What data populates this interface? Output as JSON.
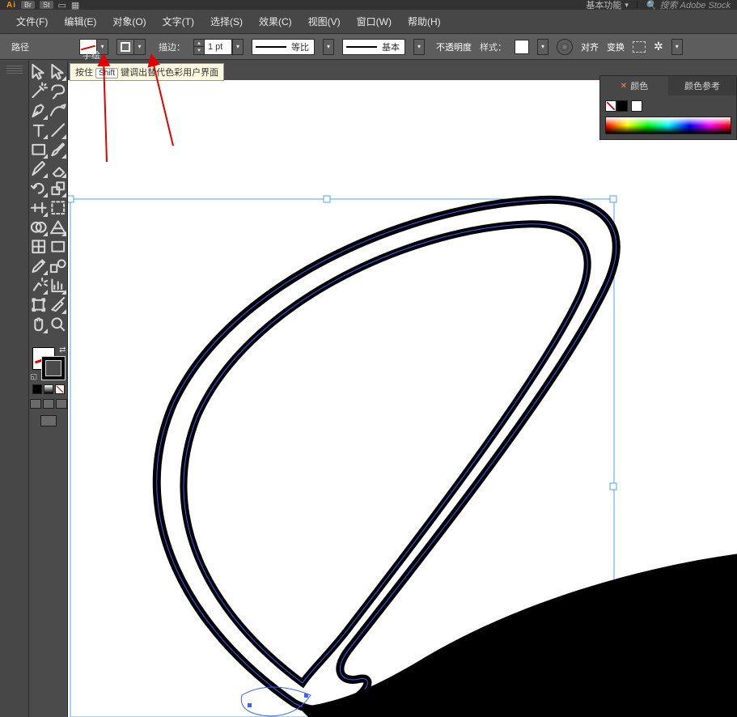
{
  "title_strip": {
    "logo": "Ai",
    "tabs": [
      "Br",
      "St"
    ],
    "icons": [
      "arrange-icon",
      "grid-icon"
    ],
    "workspace": "基本功能",
    "search_placeholder": "搜索 Adobe Stock"
  },
  "menu": {
    "file": "文件(F)",
    "edit": "编辑(E)",
    "object": "对象(O)",
    "type": "文字(T)",
    "select": "选择(S)",
    "effect": "效果(C)",
    "view": "视图(V)",
    "window": "窗口(W)",
    "help": "帮助(H)"
  },
  "ctrl": {
    "selection": "路径",
    "stroke_label": "描边：",
    "stroke_value": "1 pt",
    "profile_label": "等比",
    "brush_label": "基本",
    "opacity_label": "不透明度",
    "style_label": "样式：",
    "align_label": "对齐",
    "transform_label": "变换"
  },
  "doc_tab": "手绘",
  "tooltip": {
    "prefix": "按住",
    "key": "Shift",
    "suffix": "键调出替代色彩用户界面"
  },
  "right_panel": {
    "tab_color": "颜色",
    "tab_guide": "颜色参考"
  }
}
